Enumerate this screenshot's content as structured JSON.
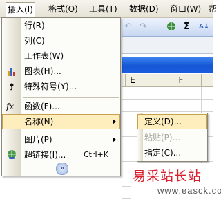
{
  "menubar": {
    "items": [
      {
        "label": "插入(I)"
      },
      {
        "label": "格式(O)"
      },
      {
        "label": "工具(T)"
      },
      {
        "label": "数据(D)"
      },
      {
        "label": "窗口(W)"
      },
      {
        "label": "帮"
      }
    ]
  },
  "toolbar": {
    "sigma": "Σ",
    "sort": "A↓"
  },
  "sheet": {
    "columns": [
      "E",
      "F"
    ]
  },
  "insert_menu": {
    "items": [
      {
        "label": "行(R)",
        "icon": "row-icon"
      },
      {
        "label": "列(C)",
        "icon": "column-icon"
      },
      {
        "label": "工作表(W)",
        "icon": ""
      },
      {
        "label": "图表(H)...",
        "icon": "chart-icon"
      },
      {
        "label": "特殊符号(Y)...",
        "icon": "symbol-icon"
      },
      {
        "label": "函数(F)...",
        "icon": "function-icon"
      },
      {
        "label": "名称(N)",
        "icon": ""
      },
      {
        "label": "图片(P)",
        "icon": ""
      },
      {
        "label": "超链接(I)...",
        "icon": "hyperlink-icon",
        "shortcut": "Ctrl+K"
      }
    ],
    "expand": "»"
  },
  "name_submenu": {
    "items": [
      {
        "label": "定义(D)...",
        "state": "highlighted"
      },
      {
        "label": "粘贴(P)...",
        "state": "disabled"
      },
      {
        "label": "指定(C)...",
        "state": "normal"
      }
    ]
  },
  "watermark": {
    "text": "易采站长站",
    "url": "www.easck.com"
  },
  "colors": {
    "highlight": "#ffeebd",
    "highlight_border": "#c6a24e",
    "titlebar": "#1556d4",
    "watermark": "#d8202c"
  }
}
